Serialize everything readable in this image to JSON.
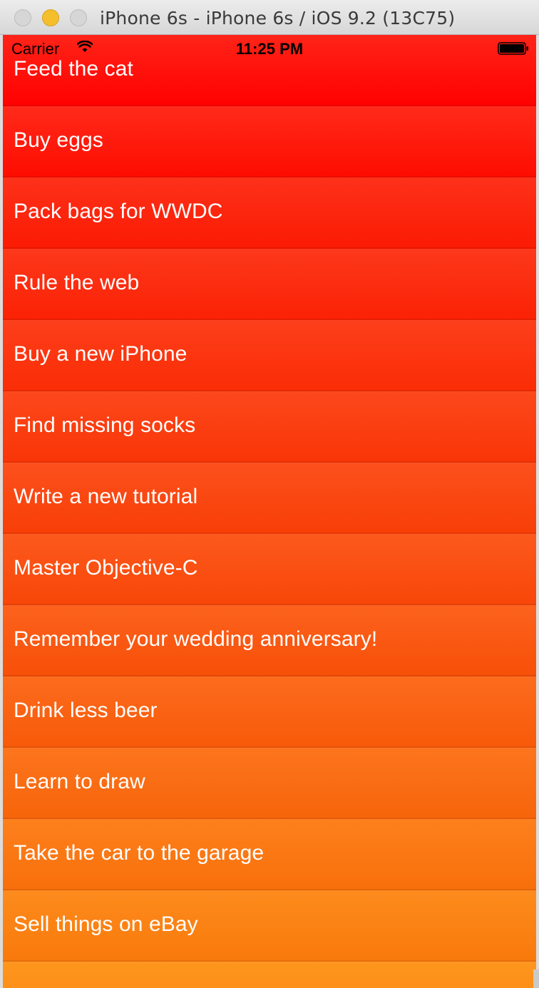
{
  "window": {
    "title": "iPhone 6s - iPhone 6s / iOS 9.2 (13C75)"
  },
  "statusbar": {
    "carrier": "Carrier",
    "time": "11:25 PM",
    "icons": [
      "wifi-icon",
      "battery-icon"
    ]
  },
  "todo": {
    "items": [
      {
        "label": "Feed the cat",
        "color_top": "#ff2318",
        "color_bottom": "#ff0000"
      },
      {
        "label": "Buy eggs",
        "color_top": "#ff2a1a",
        "color_bottom": "#fe0c00"
      },
      {
        "label": "Pack bags for WWDC",
        "color_top": "#fd311a",
        "color_bottom": "#fc1a02"
      },
      {
        "label": "Rule the web",
        "color_top": "#fd381b",
        "color_bottom": "#fb2104"
      },
      {
        "label": "Buy a new iPhone",
        "color_top": "#fd3f1b",
        "color_bottom": "#fa2c05"
      },
      {
        "label": "Find missing socks",
        "color_top": "#fc481c",
        "color_bottom": "#f93506"
      },
      {
        "label": "Write a new tutorial",
        "color_top": "#fc501c",
        "color_bottom": "#f83e07"
      },
      {
        "label": "Master Objective-C",
        "color_top": "#fc591d",
        "color_bottom": "#f84608"
      },
      {
        "label": "Remember your wedding anniversary!",
        "color_top": "#fc621d",
        "color_bottom": "#f74f08"
      },
      {
        "label": "Drink less beer",
        "color_top": "#fc6b1d",
        "color_bottom": "#f75a09"
      },
      {
        "label": "Learn to draw",
        "color_top": "#fc751d",
        "color_bottom": "#f7640a"
      },
      {
        "label": "Take the car to the garage",
        "color_top": "#fd801d",
        "color_bottom": "#f86f0a"
      },
      {
        "label": "Sell things on eBay",
        "color_top": "#fd8b1d",
        "color_bottom": "#f9790b"
      },
      {
        "label": "",
        "color_top": "#fe961e",
        "color_bottom": "#fa840c"
      }
    ]
  }
}
